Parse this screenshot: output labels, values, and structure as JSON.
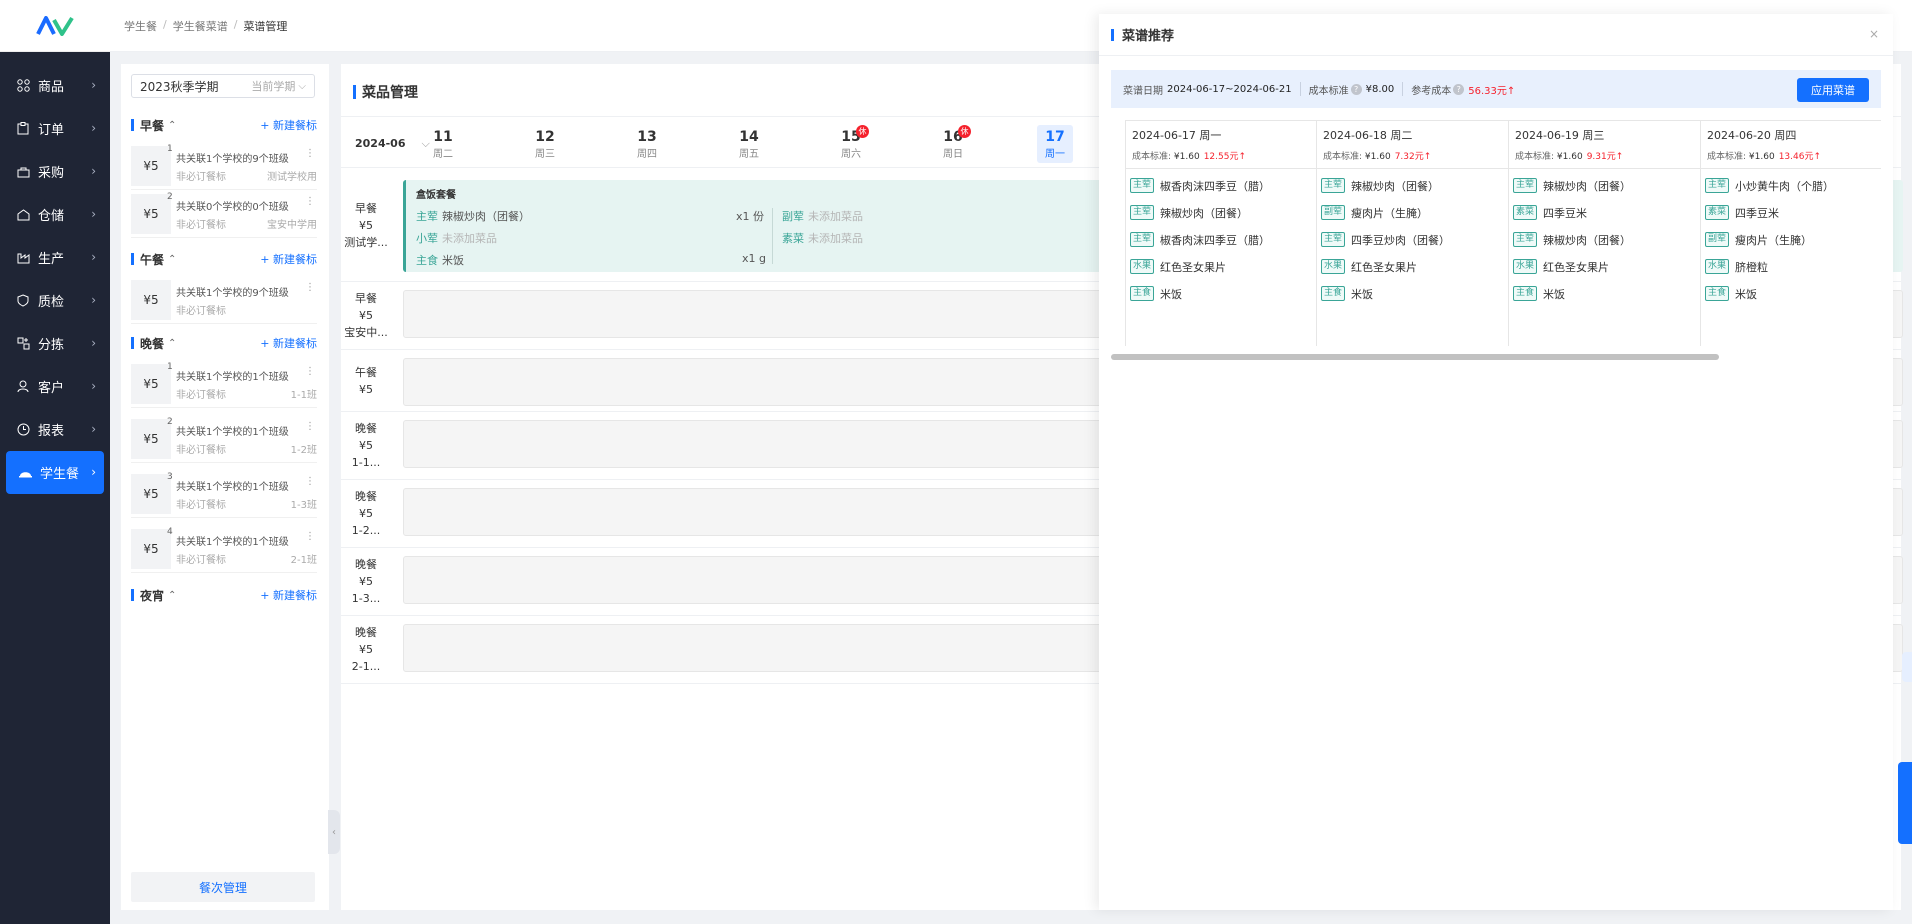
{
  "nav": {
    "items": [
      {
        "label": "商品",
        "icon": "grid-icon"
      },
      {
        "label": "订单",
        "icon": "clipboard-icon"
      },
      {
        "label": "采购",
        "icon": "bag-icon"
      },
      {
        "label": "仓储",
        "icon": "warehouse-icon"
      },
      {
        "label": "生产",
        "icon": "factory-icon"
      },
      {
        "label": "质检",
        "icon": "shield-icon"
      },
      {
        "label": "分拣",
        "icon": "sort-icon"
      },
      {
        "label": "客户",
        "icon": "user-icon"
      },
      {
        "label": "报表",
        "icon": "clock-icon"
      },
      {
        "label": "学生餐",
        "icon": "cloche-icon"
      }
    ]
  },
  "breadcrumb": {
    "a": "学生餐",
    "b": "学生餐菜谱",
    "c": "菜谱管理"
  },
  "panel": {
    "semester": "2023秋季学期",
    "semester_tag": "当前学期",
    "manage": "餐次管理",
    "sections": {
      "breakfast": "早餐",
      "lunch": "午餐",
      "dinner": "晚餐",
      "night": "夜宵",
      "add": "+ 新建餐标"
    },
    "cards": [
      {
        "price": "¥5",
        "idx": "1",
        "t1": "共关联1个学校的9个班级",
        "t2": "非必订餐标",
        "t3": "测试学校用"
      },
      {
        "price": "¥5",
        "idx": "2",
        "t1": "共关联0个学校的0个班级",
        "t2": "非必订餐标",
        "t3": "宝安中学用"
      },
      {
        "price": "¥5",
        "idx": "",
        "t1": "共关联1个学校的9个班级",
        "t2": "非必订餐标",
        "t3": ""
      },
      {
        "price": "¥5",
        "idx": "1",
        "t1": "共关联1个学校的1个班级",
        "t2": "非必订餐标",
        "t3": "1-1班"
      },
      {
        "price": "¥5",
        "idx": "2",
        "t1": "共关联1个学校的1个班级",
        "t2": "非必订餐标",
        "t3": "1-2班"
      },
      {
        "price": "¥5",
        "idx": "3",
        "t1": "共关联1个学校的1个班级",
        "t2": "非必订餐标",
        "t3": "1-3班"
      },
      {
        "price": "¥5",
        "idx": "4",
        "t1": "共关联1个学校的1个班级",
        "t2": "非必订餐标",
        "t3": "2-1班"
      }
    ]
  },
  "main": {
    "title": "菜品管理",
    "month": "2024-06",
    "days": [
      {
        "n": "11",
        "w": "周二",
        "hol": ""
      },
      {
        "n": "12",
        "w": "周三",
        "hol": ""
      },
      {
        "n": "13",
        "w": "周四",
        "hol": ""
      },
      {
        "n": "14",
        "w": "周五",
        "hol": ""
      },
      {
        "n": "15",
        "w": "周六",
        "hol": "休"
      },
      {
        "n": "16",
        "w": "周日",
        "hol": "休"
      },
      {
        "n": "17",
        "w": "周一",
        "hol": ""
      }
    ],
    "rows": [
      {
        "l1": "早餐",
        "l2": "¥5",
        "l3": "测试学..."
      },
      {
        "l1": "早餐",
        "l2": "¥5",
        "l3": "宝安中..."
      },
      {
        "l1": "午餐",
        "l2": "¥5",
        "l3": ""
      },
      {
        "l1": "晚餐",
        "l2": "¥5",
        "l3": "1-1..."
      },
      {
        "l1": "晚餐",
        "l2": "¥5",
        "l3": "1-2..."
      },
      {
        "l1": "晚餐",
        "l2": "¥5",
        "l3": "1-3..."
      },
      {
        "l1": "晚餐",
        "l2": "¥5",
        "l3": "2-1..."
      }
    ],
    "combo": {
      "title": "盒饭套餐",
      "main_k": "主荤",
      "main_v": "辣椒炒肉（团餐）",
      "main_q": "x1 份",
      "small_k": "小荤",
      "small_v": "未添加菜品",
      "staple_k": "主食",
      "staple_v": "米饭",
      "staple_q": "x1 g",
      "side_k": "副荤",
      "side_v": "未添加菜品",
      "veg_k": "素菜",
      "veg_v": "未添加菜品"
    }
  },
  "drawer": {
    "title": "菜谱推荐",
    "close": "×",
    "range_label": "菜谱日期",
    "range_value": "2024-06-17~2024-06-21",
    "cost_label": "成本标准",
    "cost_value": "¥8.00",
    "ref_label": "参考成本",
    "ref_value": "56.33元↑",
    "apply": "应用菜谱",
    "columns": [
      {
        "date": "2024-06-17 周一",
        "cost_label": "成本标准:",
        "cost": "¥1.60",
        "ref": "12.55元↑",
        "dishes": [
          {
            "tag": "主荤",
            "name": "椒香肉沫四季豆（腊）"
          },
          {
            "tag": "主荤",
            "name": "辣椒炒肉（团餐）"
          },
          {
            "tag": "主荤",
            "name": "椒香肉沫四季豆（腊）"
          },
          {
            "tag": "水果",
            "name": "红色圣女果片"
          },
          {
            "tag": "主食",
            "name": "米饭"
          }
        ]
      },
      {
        "date": "2024-06-18 周二",
        "cost_label": "成本标准:",
        "cost": "¥1.60",
        "ref": "7.32元↑",
        "dishes": [
          {
            "tag": "主荤",
            "name": "辣椒炒肉（团餐）"
          },
          {
            "tag": "副荤",
            "name": "瘦肉片（生腌）"
          },
          {
            "tag": "主荤",
            "name": "四季豆炒肉（团餐）"
          },
          {
            "tag": "水果",
            "name": "红色圣女果片"
          },
          {
            "tag": "主食",
            "name": "米饭"
          }
        ]
      },
      {
        "date": "2024-06-19 周三",
        "cost_label": "成本标准:",
        "cost": "¥1.60",
        "ref": "9.31元↑",
        "dishes": [
          {
            "tag": "主荤",
            "name": "辣椒炒肉（团餐）"
          },
          {
            "tag": "素菜",
            "name": "四季豆米"
          },
          {
            "tag": "主荤",
            "name": "辣椒炒肉（团餐）"
          },
          {
            "tag": "水果",
            "name": "红色圣女果片"
          },
          {
            "tag": "主食",
            "name": "米饭"
          }
        ]
      },
      {
        "date": "2024-06-20 周四",
        "cost_label": "成本标准:",
        "cost": "¥1.60",
        "ref": "13.46元↑",
        "dishes": [
          {
            "tag": "主荤",
            "name": "小炒黄牛肉（个腊）"
          },
          {
            "tag": "素菜",
            "name": "四季豆米"
          },
          {
            "tag": "副荤",
            "name": "瘦肉片（生腌）"
          },
          {
            "tag": "水果",
            "name": "脐橙粒"
          },
          {
            "tag": "主食",
            "name": "米饭"
          }
        ]
      }
    ]
  },
  "colors": {
    "accent": "#1470ff",
    "nav_bg": "#1f2535",
    "tag": "#3aa597",
    "up": "#f5222d"
  }
}
